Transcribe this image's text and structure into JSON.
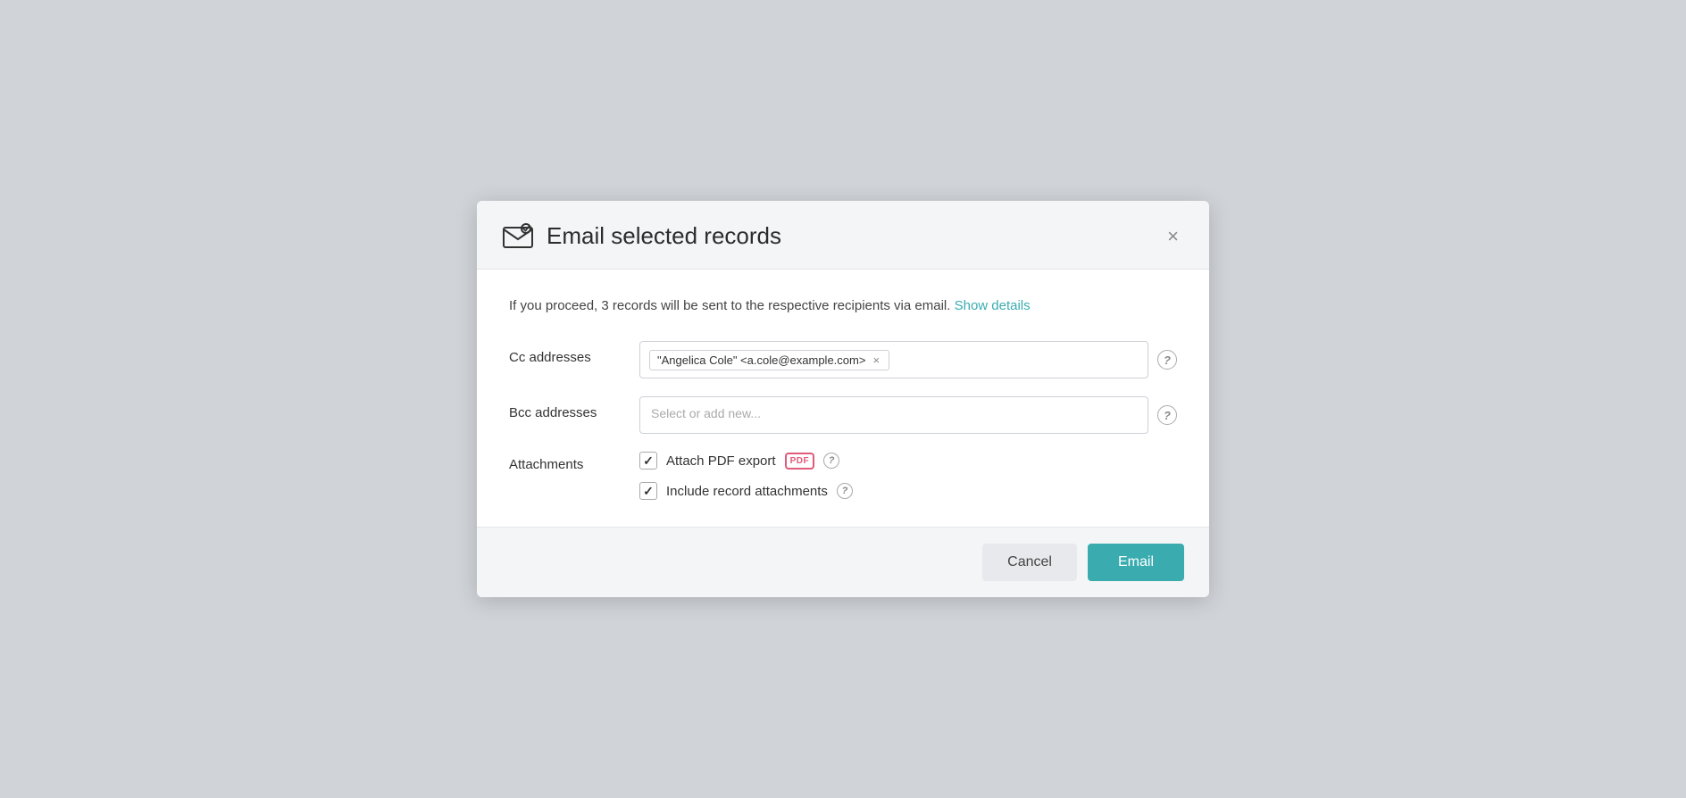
{
  "dialog": {
    "title": "Email selected records",
    "close_label": "×",
    "info_text": "If you proceed, 3 records will be sent to the respective recipients via email.",
    "show_details_label": "Show details",
    "cc_label": "Cc addresses",
    "bcc_label": "Bcc addresses",
    "attachments_label": "Attachments",
    "bcc_placeholder": "Select or add new...",
    "cc_tag_value": "\"Angelica Cole\" <a.cole@example.com>",
    "attach_pdf_label": "Attach PDF export",
    "include_attachments_label": "Include record attachments",
    "help_icon_label": "?",
    "pdf_badge_label": "PDF",
    "cancel_label": "Cancel",
    "email_label": "Email"
  }
}
